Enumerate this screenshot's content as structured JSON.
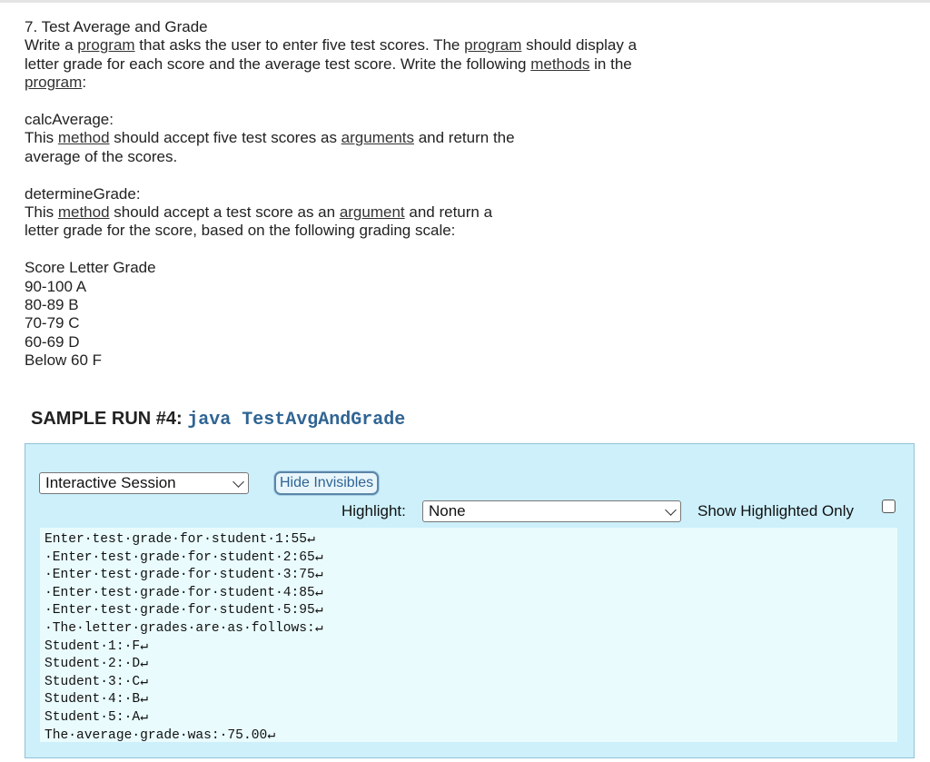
{
  "problem": {
    "title": "7. Test Average and Grade",
    "intro_1": "Write a ",
    "intro_link_1": "program",
    "intro_2": " that asks the user to enter five test scores. The ",
    "intro_link_2": "program",
    "intro_3": " should display a",
    "intro_4": "letter grade for each score and the average test score. Write the following ",
    "intro_link_3": "methods",
    "intro_5": " in the",
    "intro_link_4": "program",
    "intro_6": ":",
    "calc_heading": "calcAverage:",
    "calc_1": "This ",
    "calc_link_1": "method",
    "calc_2": " should accept five test scores as ",
    "calc_link_2": "arguments",
    "calc_3": " and return the",
    "calc_4": "average of the scores.",
    "det_heading": "determineGrade:",
    "det_1": "This ",
    "det_link_1": "method",
    "det_2": " should accept a test score as an ",
    "det_link_2": "argument",
    "det_3": " and return a",
    "det_4": "letter grade for the score, based on the following grading scale:",
    "scale": [
      "Score Letter Grade",
      "90-100 A",
      "80-89 B",
      "70-79 C",
      "60-69 D",
      "Below 60 F"
    ]
  },
  "sample_run": {
    "label": "SAMPLE RUN #4: ",
    "command": "java TestAvgAndGrade"
  },
  "controls": {
    "session_select_value": "Interactive Session",
    "hide_button_label": "Hide Invisibles",
    "highlight_label": "Highlight:",
    "highlight_select_value": "None",
    "show_highlighted_label": "Show Highlighted Only",
    "show_highlighted_checked": false
  },
  "output_lines": [
    "Enter·test·grade·for·student·1:55↵",
    "·Enter·test·grade·for·student·2:65↵",
    "·Enter·test·grade·for·student·3:75↵",
    "·Enter·test·grade·for·student·4:85↵",
    "·Enter·test·grade·for·student·5:95↵",
    "·The·letter·grades·are·as·follows:↵",
    "Student·1:·F↵",
    "Student·2:·D↵",
    "Student·3:·C↵",
    "Student·4:·B↵",
    "Student·5:·A↵",
    "The·average·grade·was:·75.00↵"
  ]
}
